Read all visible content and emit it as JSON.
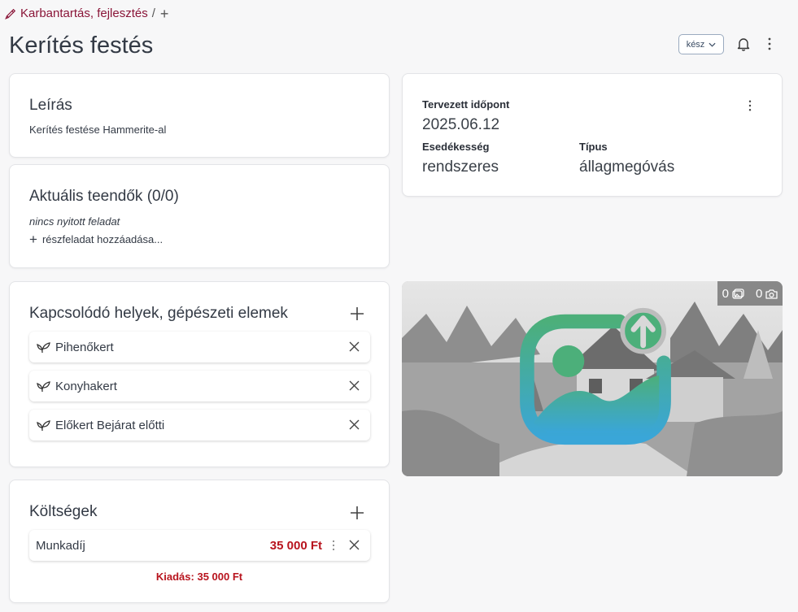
{
  "breadcrumb": {
    "category": "Karbantartás, fejlesztés",
    "separator": "/",
    "icon": "paint-brush-icon",
    "add_icon": "plus-icon"
  },
  "page": {
    "title": "Kerítés festés"
  },
  "header": {
    "status_label": "kész",
    "bell_icon": "bell-icon",
    "menu_icon": "kebab-icon"
  },
  "description": {
    "title": "Leírás",
    "text": "Kerítés festése Hammerite-al"
  },
  "todos": {
    "title": "Aktuális teendők (0/0)",
    "empty_text": "nincs nyitott feladat",
    "add_label": "részfeladat hozzáadása..."
  },
  "schedule": {
    "planned_label": "Tervezett időpont",
    "planned_value": "2025.06.12",
    "due_label": "Esedékesség",
    "due_value": "rendszeres",
    "type_label": "Típus",
    "type_value": "állagmegóvás"
  },
  "places": {
    "title": "Kapcsolódó helyek, gépészeti elemek",
    "items": [
      {
        "label": "Pihenőkert",
        "icon": "sprout-icon"
      },
      {
        "label": "Konyhakert",
        "icon": "sprout-icon"
      },
      {
        "label": "Előkert Bejárat előtti",
        "icon": "sprout-icon"
      }
    ]
  },
  "costs": {
    "title": "Költségek",
    "items": [
      {
        "name": "Munkadíj",
        "amount": "35 000 Ft"
      }
    ],
    "total": "Kiadás: 35 000 Ft"
  },
  "gallery": {
    "image_count": "0",
    "photo_count": "0",
    "upload_icon": "image-upload-icon"
  },
  "colors": {
    "accent": "#8a1538",
    "cost": "#b8141e",
    "upload_gradient_top": "#4caf7a",
    "upload_gradient_bottom": "#3aa6d8"
  }
}
